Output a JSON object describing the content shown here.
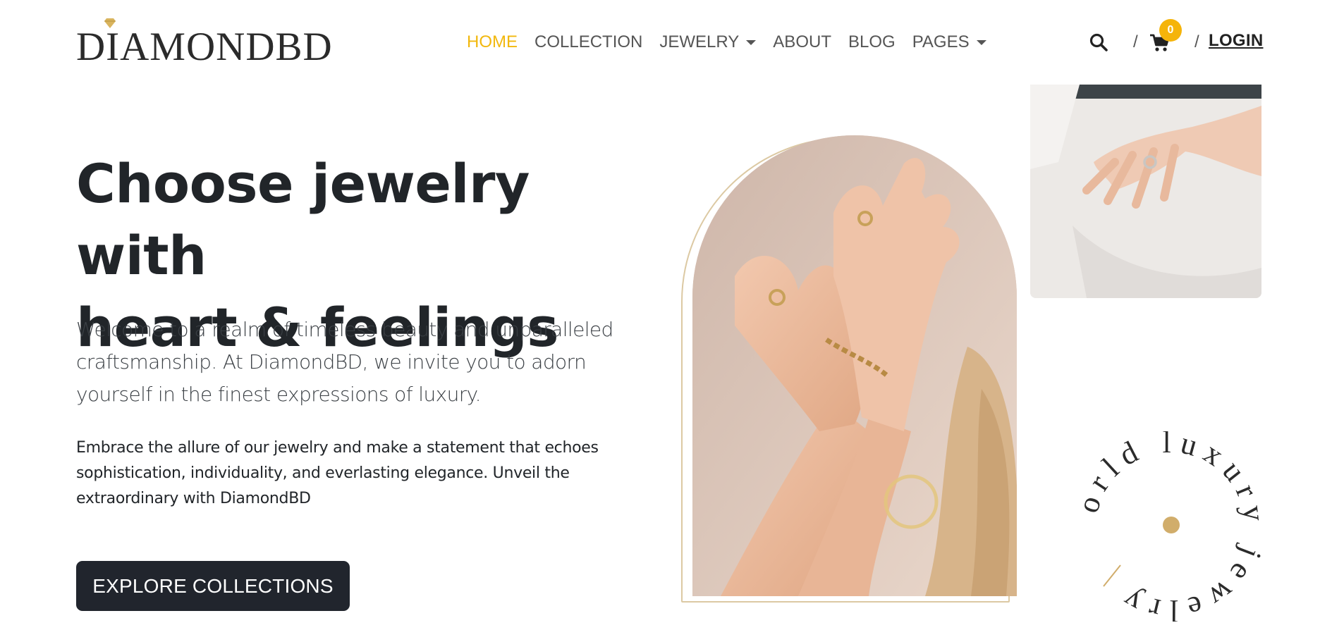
{
  "brand": {
    "name": "DIAMONDBD",
    "accent": "#f2b80e",
    "dark": "#212529"
  },
  "nav": {
    "items": [
      {
        "label": "HOME",
        "active": true
      },
      {
        "label": "COLLECTION",
        "active": false
      },
      {
        "label": "JEWELRY",
        "active": false,
        "dropdown": true
      },
      {
        "label": "ABOUT",
        "active": false
      },
      {
        "label": "BLOG",
        "active": false
      },
      {
        "label": "PAGES",
        "active": false,
        "dropdown": true
      }
    ]
  },
  "tools": {
    "separator": "/",
    "cart_count": "0",
    "login_label": "LOGIN",
    "icons": [
      "search-icon",
      "cart-icon"
    ]
  },
  "hero": {
    "title_line1": "Choose jewelry with",
    "title_line2": "heart & feelings",
    "lead": "Welcome to a realm of timeless beauty and unparalleled craftsmanship. At DiamondBD, we invite you to adorn yourself in the finest expressions of luxury.",
    "body": "Embrace the allure of our jewelry and make a statement that echoes sophistication, individuality, and everlasting elegance. Unveil the extraordinary with DiamondBD",
    "cta_label": "EXPLORE COLLECTIONS"
  },
  "badge": {
    "text": "world luxury jewelry"
  }
}
